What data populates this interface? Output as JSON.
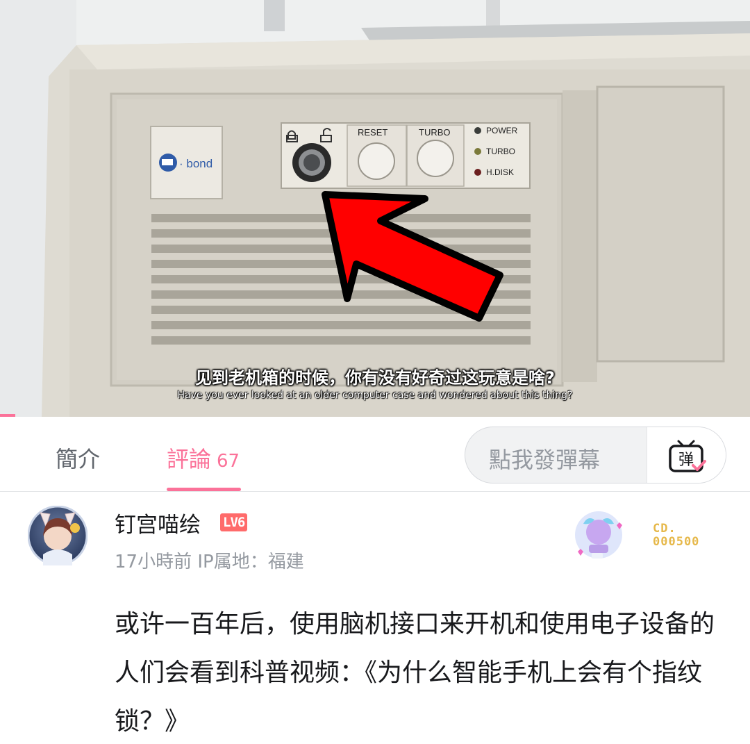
{
  "video": {
    "progress": 0.02,
    "subtitle_zh": "见到老机箱的时候，你有没有好奇过这玩意是啥?",
    "subtitle_en": "Have you ever looked at an older computer case and wondered about this thing?",
    "case_brand": "bond",
    "buttons": {
      "reset": "RESET",
      "turbo": "TURBO"
    },
    "leds": [
      "POWER",
      "TURBO",
      "H.DISK"
    ]
  },
  "tabs": {
    "intro": "簡介",
    "comments": "評論",
    "comments_count": "67"
  },
  "danmaku": {
    "placeholder": "點我發彈幕",
    "button_glyph": "弹"
  },
  "comment": {
    "username": "钉宫喵绘",
    "level": "LV6",
    "time": "17小時前",
    "ip": "IP属地：福建",
    "fan_number_prefix": "CD.",
    "fan_number": "000500",
    "text": "或许一百年后，使用脑机接口来开机和使用电子设备的人们会看到科普视频：《为什么智能手机上会有个指纹锁？》"
  },
  "colors": {
    "accent": "#fb7299",
    "level": "#ff6b6b",
    "fan_gold": "#e6b84a",
    "arrow": "#ff0000"
  }
}
